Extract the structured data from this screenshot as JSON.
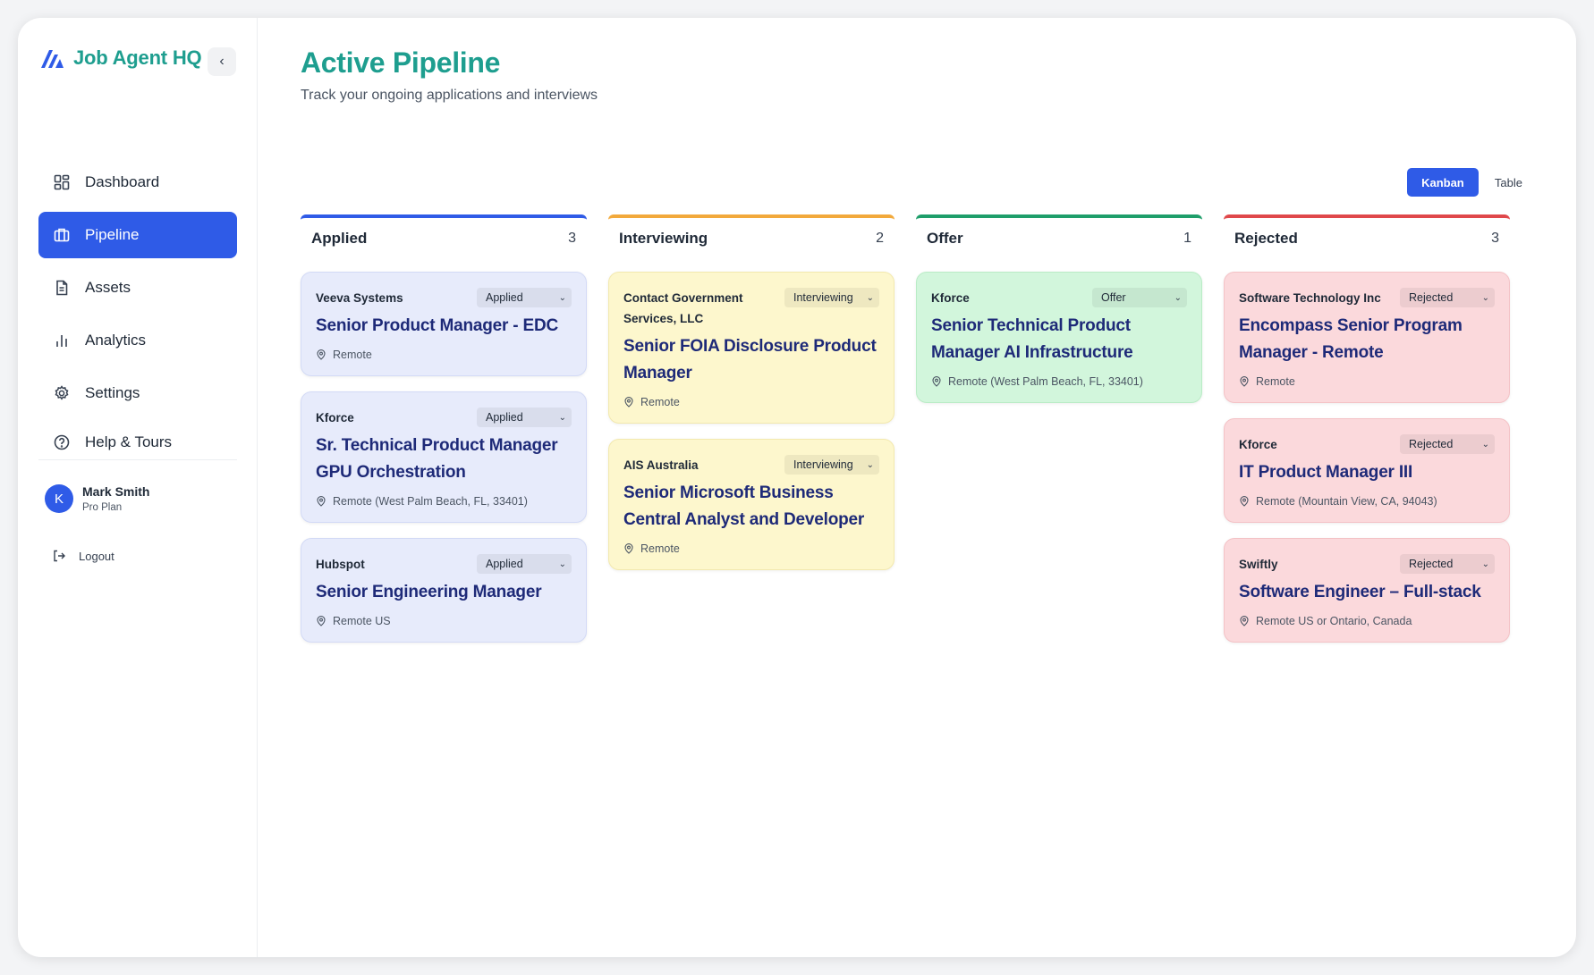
{
  "app": {
    "name": "Job Agent HQ",
    "collapse_icon": "chevron-left-icon"
  },
  "sidebar": {
    "items": [
      {
        "label": "Dashboard",
        "icon": "dashboard-grid-icon",
        "active": false
      },
      {
        "label": "Pipeline",
        "icon": "briefcase-icon",
        "active": true
      },
      {
        "label": "Assets",
        "icon": "document-icon",
        "active": false
      },
      {
        "label": "Analytics",
        "icon": "bar-chart-icon",
        "active": false
      },
      {
        "label": "Settings",
        "icon": "gear-icon",
        "active": false
      },
      {
        "label": "Help & Tours",
        "icon": "help-circle-icon",
        "active": false
      }
    ],
    "user": {
      "initial": "K",
      "name": "Mark Smith",
      "plan": "Pro Plan"
    },
    "logout_label": "Logout"
  },
  "page": {
    "title": "Active Pipeline",
    "subtitle": "Track your ongoing applications and interviews"
  },
  "view_toggle": {
    "kanban": "Kanban",
    "table": "Table",
    "selected": "Kanban"
  },
  "colors": {
    "brand": "#1e9e8f",
    "accent": "#2f5be7",
    "applied": "#2f5be7",
    "interviewing": "#f2a93b",
    "offer": "#1e9e6a",
    "rejected": "#e0484b"
  },
  "columns": [
    {
      "name": "Applied",
      "count": "3",
      "key": "applied",
      "cards": [
        {
          "company": "Veeva Systems",
          "status": "Applied",
          "role": "Senior Product Manager - EDC",
          "location": "Remote"
        },
        {
          "company": "Kforce",
          "status": "Applied",
          "role": "Sr. Technical Product Manager GPU Orchestration",
          "location": "Remote (West Palm Beach, FL, 33401)"
        },
        {
          "company": "Hubspot",
          "status": "Applied",
          "role": "Senior Engineering Manager",
          "location": "Remote US"
        }
      ]
    },
    {
      "name": "Interviewing",
      "count": "2",
      "key": "interviewing",
      "cards": [
        {
          "company": "Contact Government Services, LLC",
          "status": "Interviewing",
          "role": "Senior FOIA Disclosure Product Manager",
          "location": "Remote"
        },
        {
          "company": "AIS Australia",
          "status": "Interviewing",
          "role": "Senior Microsoft Business Central Analyst and Developer",
          "location": "Remote"
        }
      ]
    },
    {
      "name": "Offer",
      "count": "1",
      "key": "offer",
      "cards": [
        {
          "company": "Kforce",
          "status": "Offer",
          "role": "Senior Technical Product Manager AI Infrastructure",
          "location": "Remote (West Palm Beach, FL, 33401)"
        }
      ]
    },
    {
      "name": "Rejected",
      "count": "3",
      "key": "rejected",
      "cards": [
        {
          "company": "Software Technology Inc",
          "status": "Rejected",
          "role": "Encompass Senior Program Manager - Remote",
          "location": "Remote"
        },
        {
          "company": "Kforce",
          "status": "Rejected",
          "role": "IT Product Manager III",
          "location": "Remote (Mountain View, CA, 94043)"
        },
        {
          "company": "Swiftly",
          "status": "Rejected",
          "role": "Software Engineer – Full-stack",
          "location": "Remote US or Ontario, Canada"
        }
      ]
    }
  ]
}
